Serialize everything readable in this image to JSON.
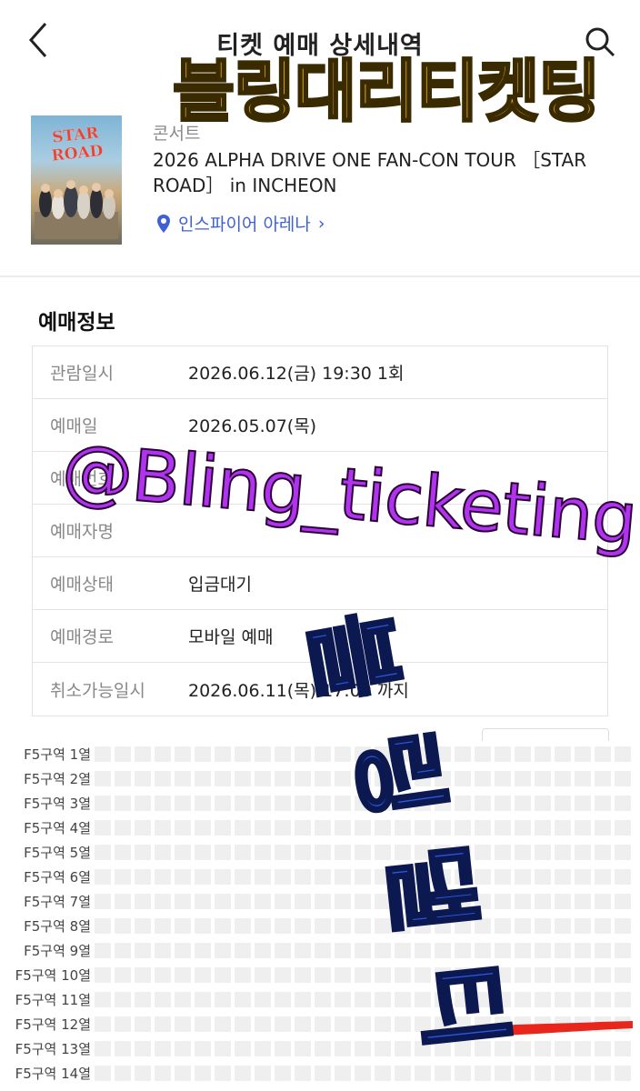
{
  "header": {
    "title": "티켓 예매 상세내역",
    "back_icon": "chevron-left-icon",
    "search_icon": "search-icon"
  },
  "watermarks": {
    "top": "블링대리티켓팅",
    "handle": "@Bling_ticketing",
    "vertical": [
      "블",
      "링",
      "댈",
      "티"
    ]
  },
  "event": {
    "category": "콘서트",
    "title": "2026 ALPHA DRIVE ONE FAN-CON TOUR ［STAR ROAD］ in INCHEON",
    "venue": "인스파이어 아레나",
    "venue_chevron": "›",
    "poster_text": "STAR ROAD"
  },
  "booking_info": {
    "section_title": "예매정보",
    "rows": [
      {
        "label": "관람일시",
        "value": "2026.06.12(금) 19:30 1회"
      },
      {
        "label": "예매일",
        "value": "2026.05.07(목)"
      },
      {
        "label": "예매번호",
        "value": ""
      },
      {
        "label": "예매자명",
        "value": ""
      },
      {
        "label": "예매상태",
        "value": "입금대기"
      },
      {
        "label": "예매경로",
        "value": "모바일 예매"
      },
      {
        "label": "취소가능일시",
        "value": "2026.06.11(목) 17:00 까지"
      }
    ]
  },
  "seat_map": {
    "rows": [
      "F5구역 1열",
      "F5구역 2열",
      "F5구역 3열",
      "F5구역 4열",
      "F5구역 5열",
      "F5구역 6열",
      "F5구역 7열",
      "F5구역 8열",
      "F5구역 9열",
      "F5구역 10열",
      "F5구역 11열",
      "F5구역 12열",
      "F5구역 13열",
      "F5구역 14열"
    ]
  },
  "colors": {
    "accent_blue": "#4060d8",
    "watermark_yellow": "#f2b90f",
    "watermark_purple": "#b033f0",
    "watermark_blue": "#2f56e0",
    "highlight_red": "#e8261c"
  }
}
